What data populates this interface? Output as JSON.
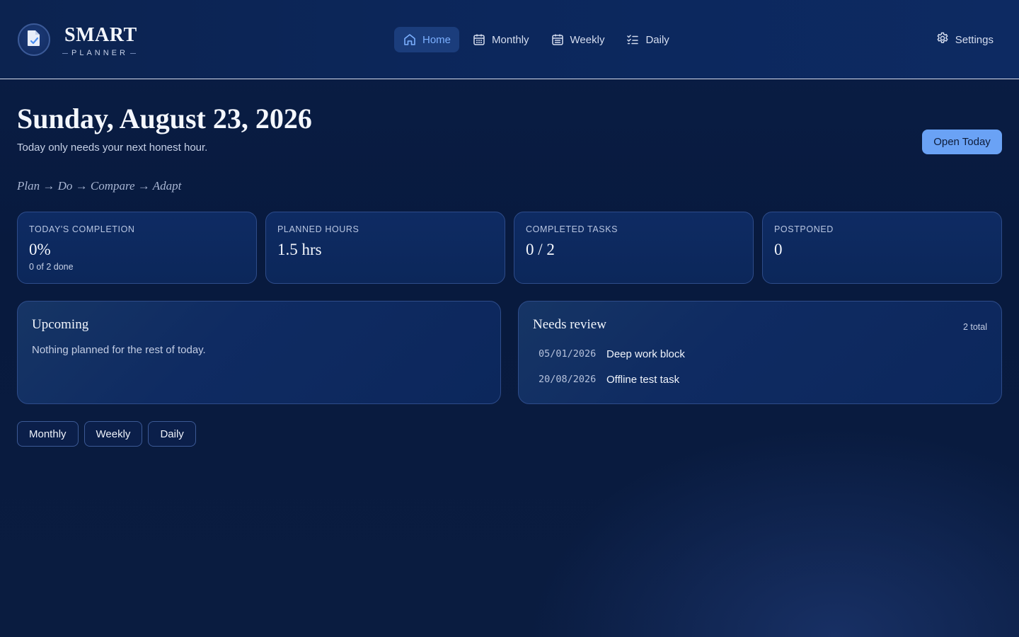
{
  "brand": {
    "title": "SMART",
    "subtitle": "PLANNER",
    "logo_icon": "checked-document-icon"
  },
  "nav": {
    "items": [
      {
        "label": "Home",
        "icon": "home-icon",
        "active": true
      },
      {
        "label": "Monthly",
        "icon": "calendar-icon",
        "active": false
      },
      {
        "label": "Weekly",
        "icon": "calendar-icon",
        "active": false
      },
      {
        "label": "Daily",
        "icon": "checklist-icon",
        "active": false
      }
    ],
    "settings_label": "Settings"
  },
  "header": {
    "date": "Sunday, August 23, 2026",
    "subtitle": "Today only needs your next honest hour.",
    "open_today_label": "Open Today",
    "workflow": "Plan → Do → Compare → Adapt"
  },
  "stats": [
    {
      "label": "TODAY'S COMPLETION",
      "value": "0%",
      "note": "0 of 2 done"
    },
    {
      "label": "PLANNED HOURS",
      "value": "1.5 hrs",
      "note": ""
    },
    {
      "label": "COMPLETED TASKS",
      "value": "0 / 2",
      "note": ""
    },
    {
      "label": "POSTPONED",
      "value": "0",
      "note": ""
    }
  ],
  "upcoming": {
    "title": "Upcoming",
    "empty_text": "Nothing planned for the rest of today."
  },
  "needs_review": {
    "title": "Needs review",
    "count_label": "2 total",
    "items": [
      {
        "date": "05/01/2026",
        "name": "Deep work block"
      },
      {
        "date": "20/08/2026",
        "name": "Offline test task"
      }
    ]
  },
  "quick_links": [
    "Monthly",
    "Weekly",
    "Daily"
  ],
  "colors": {
    "accent": "#6aa2f5",
    "active_nav": "#7cb0ff",
    "background": "#081a3e"
  }
}
